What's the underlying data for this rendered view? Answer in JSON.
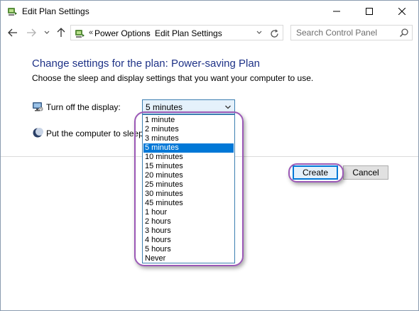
{
  "window": {
    "title": "Edit Plan Settings",
    "icons": {
      "app": "power-options-icon",
      "minimize": "minimize-icon",
      "maximize": "maximize-icon",
      "close": "close-icon"
    }
  },
  "address": {
    "chevrons": "«",
    "separator": "›",
    "crumbs": [
      "Power Options",
      "Edit Plan Settings"
    ],
    "icons": {
      "back": "back-arrow-icon",
      "forward": "forward-arrow-icon",
      "recent": "chevron-down-icon",
      "up": "up-arrow-icon",
      "refresh": "refresh-icon"
    }
  },
  "search": {
    "placeholder": "Search Control Panel",
    "icon": "search-icon"
  },
  "content": {
    "heading": "Change settings for the plan: Power-saving Plan",
    "description": "Choose the sleep and display settings that you want your computer to use.",
    "display": {
      "label": "Turn off the display:",
      "value": "5 minutes",
      "icon": "monitor-icon"
    },
    "sleep": {
      "label": "Put the computer to sleep:",
      "icon": "moon-icon"
    }
  },
  "dropdown": {
    "options": [
      "1 minute",
      "2 minutes",
      "3 minutes",
      "5 minutes",
      "10 minutes",
      "15 minutes",
      "20 minutes",
      "25 minutes",
      "30 minutes",
      "45 minutes",
      "1 hour",
      "2 hours",
      "3 hours",
      "4 hours",
      "5 hours",
      "Never"
    ],
    "selected": "5 minutes"
  },
  "buttons": {
    "create": "Create",
    "cancel": "Cancel"
  },
  "colors": {
    "heading": "#1e3287",
    "selection": "#0078d7",
    "highlight": "#9b59b6"
  }
}
